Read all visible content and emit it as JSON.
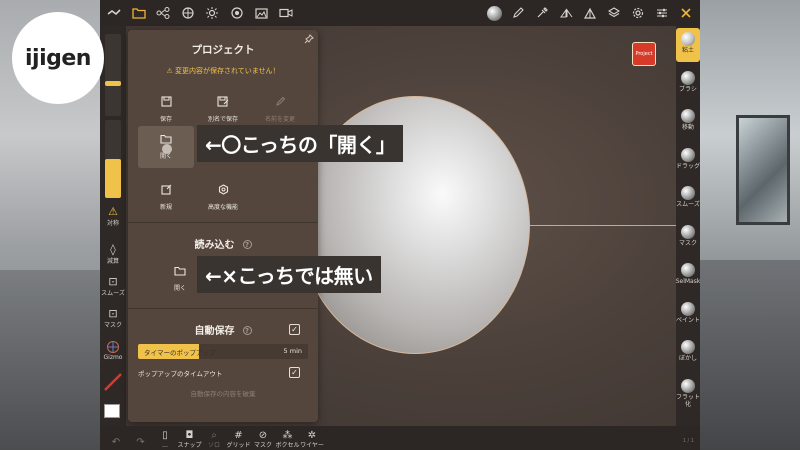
{
  "logo": {
    "text": "ijigen"
  },
  "topbar": {
    "left_icons": [
      "menu-icon",
      "folder-icon",
      "scene-graph-icon",
      "globe-icon",
      "sun-icon",
      "material-icon",
      "image-icon",
      "video-icon"
    ],
    "right_icons": [
      "matcap-ball-icon",
      "pen-icon",
      "eyedropper-icon",
      "symmetry-icon",
      "triangle-icon",
      "layers-icon",
      "settings-icon",
      "sliders-icon",
      "tools-icon"
    ]
  },
  "left_toolbar": {
    "symmetry_label": "対称",
    "decimate_label": "減算",
    "smooth_label": "スムーズ",
    "mask_label": "マスク",
    "gizmo_label": "Gizmo",
    "slider_radius": 0.06,
    "slider_intensity": 0.5
  },
  "right_toolbar": {
    "tools": [
      {
        "label": "粘土",
        "active": true
      },
      {
        "label": "ブラシ",
        "active": false
      },
      {
        "label": "移動",
        "active": false
      },
      {
        "label": "ドラッグ",
        "active": false
      },
      {
        "label": "スムーズ",
        "active": false
      },
      {
        "label": "マスク",
        "active": false
      },
      {
        "label": "SelMask",
        "active": false
      },
      {
        "label": "ペイント",
        "active": false
      },
      {
        "label": "ぼかし",
        "active": false
      },
      {
        "label": "フラット化",
        "active": false
      }
    ],
    "project_badge": "Project"
  },
  "bottom_toolbar": {
    "tools": [
      {
        "label": "",
        "icon": "undo-icon",
        "dim": true
      },
      {
        "label": "",
        "icon": "redo-icon",
        "dim": true
      },
      {
        "label": "...",
        "icon": "phone-icon",
        "dim": false
      },
      {
        "label": "スナップ",
        "icon": "camera-icon",
        "dim": false
      },
      {
        "label": "ソロ",
        "icon": "search-icon",
        "dim": true
      },
      {
        "label": "グリッド",
        "icon": "grid-icon",
        "dim": false
      },
      {
        "label": "マスク",
        "icon": "eye-slash-icon",
        "dim": false
      },
      {
        "label": "ボクセル",
        "icon": "voxel-icon",
        "dim": false
      },
      {
        "label": "ワイヤー",
        "icon": "wireframe-icon",
        "dim": false
      }
    ],
    "page_indicator": "1 / 1"
  },
  "panel": {
    "title": "プロジェクト",
    "warning": "⚠ 変更内容が保存されていません！",
    "buttons": {
      "save": "保存",
      "save_as": "別名で保存",
      "rename": "名前を変更",
      "open": "開く",
      "new": "新規",
      "advanced": "高度な機能"
    },
    "import_title": "読み込む",
    "import_open": "開く",
    "autosave_title": "自動保存",
    "autosave_enabled": true,
    "timer_popup_label": "タイマーのポップアップ",
    "timer_value": "5 min",
    "timer_fraction": 0.36,
    "popup_timeout_label": "ポップアップのタイムアウト",
    "popup_timeout_enabled": true,
    "discard_label": "自動保存の内容を破棄"
  },
  "captions": {
    "open_this": "←〇こっちの「開く」",
    "not_this": "←×こっちでは無い"
  }
}
